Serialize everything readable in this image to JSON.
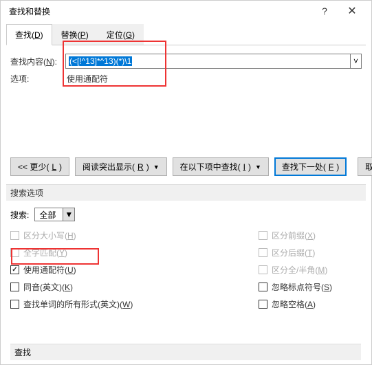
{
  "titlebar": {
    "title": "查找和替换",
    "help": "?",
    "close": "✕"
  },
  "tabs": {
    "find": {
      "label_pre": "查找(",
      "key": "D",
      "label_post": ")"
    },
    "replace": {
      "label_pre": "替换(",
      "key": "P",
      "label_post": ")"
    },
    "goto": {
      "label_pre": "定位(",
      "key": "G",
      "label_post": ")"
    }
  },
  "find": {
    "label_pre": "查找内容(",
    "key": "N",
    "label_post": "):",
    "value": "(<[!^13]*^13)(*)\\1",
    "opt_label": "选项:",
    "opt_value": "使用通配符"
  },
  "buttons": {
    "less_pre": "<< 更少(",
    "less_key": "L",
    "less_post": ")",
    "highlight_pre": "阅读突出显示(",
    "highlight_key": "R",
    "highlight_post": ")",
    "findin_pre": "在以下项中查找(",
    "findin_key": "I",
    "findin_post": ")",
    "findnext_pre": "查找下一处(",
    "findnext_key": "F",
    "findnext_post": ")",
    "cancel": "取消"
  },
  "options": {
    "section": "搜索选项",
    "search_label": "搜索:",
    "search_value": "全部",
    "left": [
      {
        "pre": "区分大小写(",
        "key": "H",
        "post": ")",
        "disabled": true,
        "checked": false
      },
      {
        "pre": "全字匹配(",
        "key": "Y",
        "post": ")",
        "disabled": true,
        "checked": false
      },
      {
        "pre": "使用通配符(",
        "key": "U",
        "post": ")",
        "disabled": false,
        "checked": true
      },
      {
        "pre": "同音(英文)(",
        "key": "K",
        "post": ")",
        "disabled": false,
        "checked": false
      },
      {
        "pre": "查找单词的所有形式(英文)(",
        "key": "W",
        "post": ")",
        "disabled": false,
        "checked": false
      }
    ],
    "right": [
      {
        "pre": "区分前缀(",
        "key": "X",
        "post": ")",
        "disabled": true,
        "checked": false
      },
      {
        "pre": "区分后缀(",
        "key": "T",
        "post": ")",
        "disabled": true,
        "checked": false
      },
      {
        "pre": "区分全/半角(",
        "key": "M",
        "post": ")",
        "disabled": true,
        "checked": false
      },
      {
        "pre": "忽略标点符号(",
        "key": "S",
        "post": ")",
        "disabled": false,
        "checked": false
      },
      {
        "pre": "忽略空格(",
        "key": "A",
        "post": ")",
        "disabled": false,
        "checked": false
      }
    ]
  },
  "bottom": {
    "label": "查找"
  }
}
